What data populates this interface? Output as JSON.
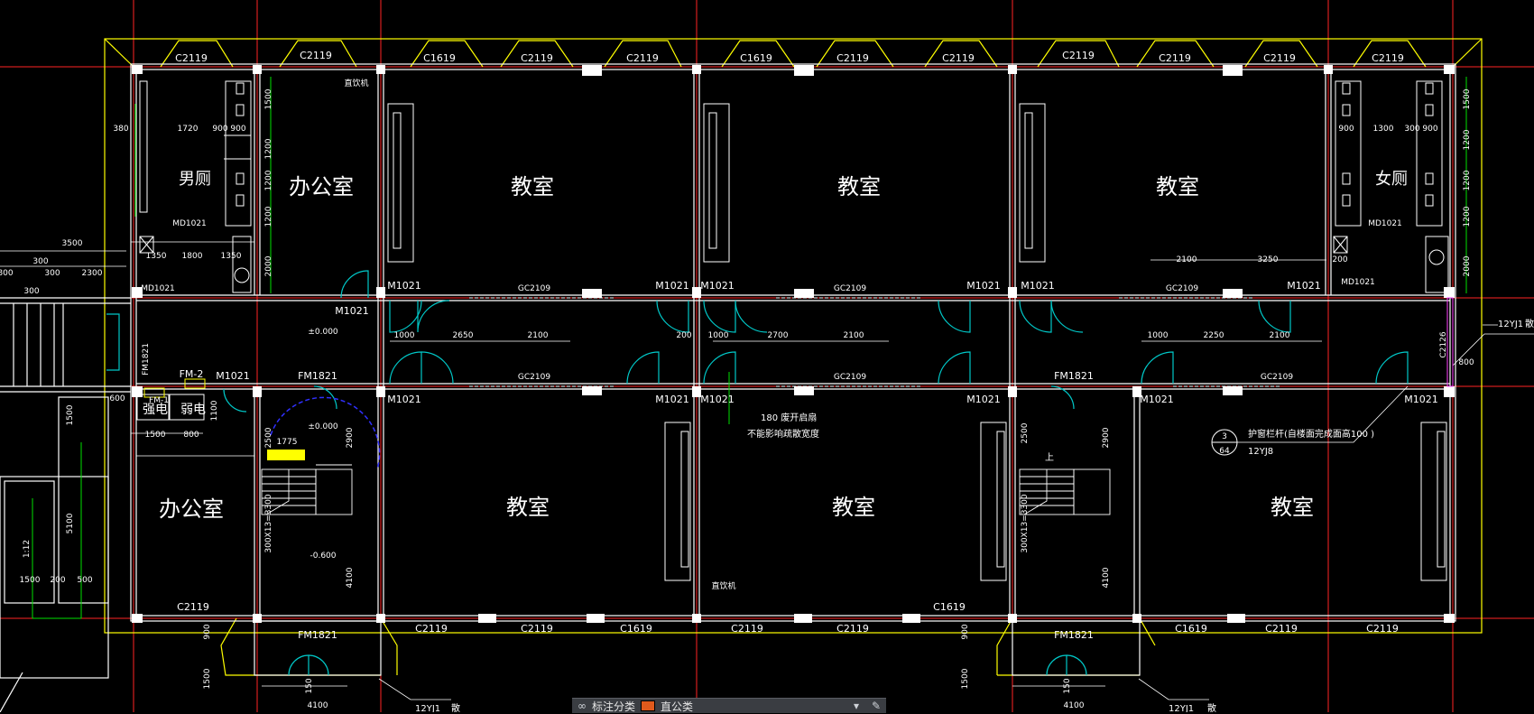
{
  "rooms": {
    "mens_wc": "男厕",
    "womens_wc": "女厕",
    "office": "办公室",
    "classroom": "教室",
    "strong_current": "强电",
    "weak_current": "弱电"
  },
  "windows": {
    "c2119": "C2119",
    "c1619": "C1619",
    "c2126": "C2126",
    "gc2109": "GC2109"
  },
  "doors": {
    "m1021": "M1021",
    "md1021": "MD1021",
    "fm1821": "FM1821",
    "fm1": "FM-1",
    "fm2": "FM-2",
    "fm1821_side": "FM1821"
  },
  "notes": {
    "water_dispenser": "直饮机",
    "elev_000": "±0.000",
    "elev_600": "-0.600",
    "swing_door_180": "180  废开启扇",
    "no_width_effect": "不能影响疏散宽度",
    "railing_note": "护窗栏杆(自楼面完成面高100 )",
    "ref_3": "3",
    "ref_64": "64",
    "std_12yj8": "12YJ8",
    "std_12yj1_a": "12YJ1",
    "std_12yj1_b": "12YJ1",
    "std_12yj1_c": "12YJ1",
    "ext_a": "散",
    "ext_b": "散",
    "ext_c": "散",
    "up": "上",
    "ramp": "1:12",
    "stair_1": "300X13=3300",
    "stair_2": "300X13=3300"
  },
  "dims": {
    "d3500": "3500",
    "d300": "300",
    "d2300": "2300",
    "d800": "800",
    "d600": "600",
    "d1500": "1500",
    "d5100": "5100",
    "d500": "500",
    "d200": "200",
    "d1720": "1720",
    "d380": "380",
    "d900": "900",
    "d1200": "1200",
    "d2000": "2000",
    "d1350": "1350",
    "d1800": "1800",
    "d1300": "1300",
    "d2100": "2100",
    "d3250": "3250",
    "d1000": "1000",
    "d2650": "2650",
    "d2700": "2700",
    "d2250": "2250",
    "d2500": "2500",
    "d2900": "2900",
    "d1775": "1775",
    "d4100": "4100",
    "d150": "150",
    "d1100": "1100"
  },
  "status_bar": {
    "label": "标注分类",
    "layer": "直公类"
  },
  "colors": {
    "background": "#000000",
    "axis": "#ff2020",
    "wall": "#ffffff",
    "window": "#ffff00",
    "door": "#00c0c0",
    "dim": "#00ff00",
    "text": "#ffffff"
  }
}
